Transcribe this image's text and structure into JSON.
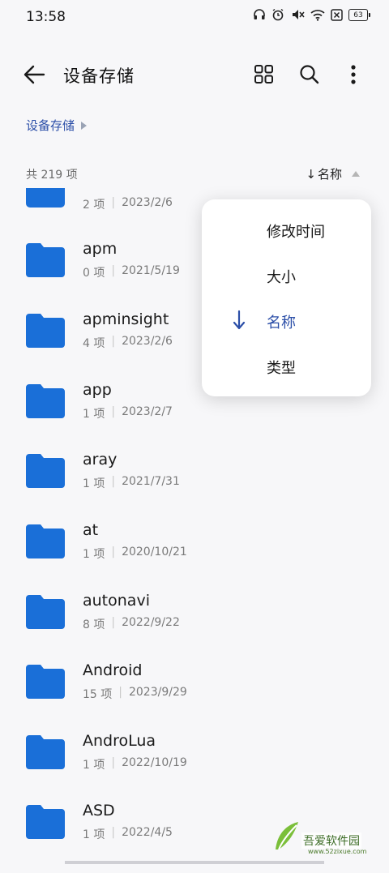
{
  "status_bar": {
    "time": "13:58",
    "battery": "63",
    "icons": [
      "headphones-icon",
      "alarm-icon",
      "mute-icon",
      "wifi-icon",
      "sim-off-icon",
      "battery-icon"
    ]
  },
  "app_bar": {
    "title": "设备存储",
    "icons": [
      "back-arrow-icon",
      "grid-view-icon",
      "search-icon",
      "more-vert-icon"
    ]
  },
  "breadcrumb": {
    "items": [
      "设备存储"
    ]
  },
  "list_header": {
    "count": "共 219 项",
    "sort_arrow": "↓",
    "sort_label": "名称"
  },
  "files": [
    {
      "name": "",
      "items": "2 项",
      "date": "2023/2/6"
    },
    {
      "name": "apm",
      "items": "0 项",
      "date": "2021/5/19"
    },
    {
      "name": "apminsight",
      "items": "4 项",
      "date": "2023/2/6"
    },
    {
      "name": "app",
      "items": "1 项",
      "date": "2023/2/7"
    },
    {
      "name": "aray",
      "items": "1 项",
      "date": "2021/7/31"
    },
    {
      "name": "at",
      "items": "1 项",
      "date": "2020/10/21"
    },
    {
      "name": "autonavi",
      "items": "8 项",
      "date": "2022/9/22"
    },
    {
      "name": "Android",
      "items": "15 项",
      "date": "2023/9/29"
    },
    {
      "name": "AndroLua",
      "items": "1 项",
      "date": "2022/10/19"
    },
    {
      "name": "ASD",
      "items": "1 项",
      "date": "2022/4/5"
    }
  ],
  "sort_menu": {
    "options": [
      {
        "label": "修改时间",
        "selected": false
      },
      {
        "label": "大小",
        "selected": false
      },
      {
        "label": "名称",
        "selected": true
      },
      {
        "label": "类型",
        "selected": false
      }
    ],
    "selected_mark": "↓"
  },
  "watermark": {
    "title": "吾爱软件园",
    "url": "www.52zixue.com"
  },
  "colors": {
    "background": "#f7f7f9",
    "accent": "#2c4fa8",
    "folder": "#1a6fd8",
    "secondary_text": "#7a7a7a"
  }
}
